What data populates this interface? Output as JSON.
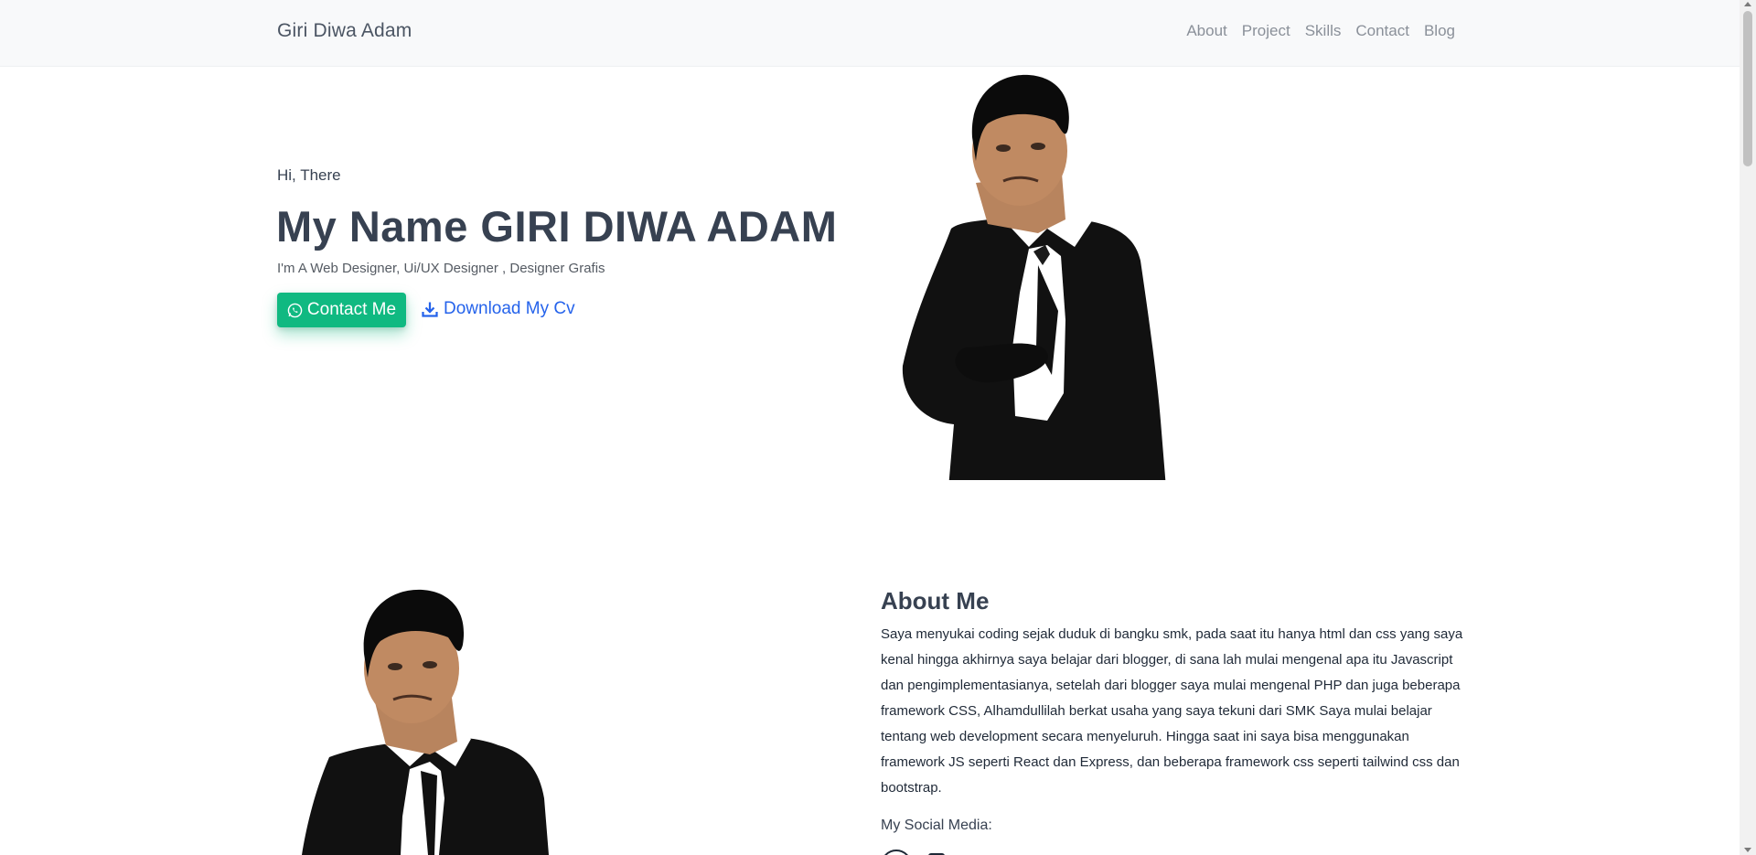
{
  "navbar": {
    "brand": "Giri Diwa Adam",
    "links": [
      "About",
      "Project",
      "Skills",
      "Contact",
      "Blog"
    ]
  },
  "hero": {
    "greeting": "Hi, There",
    "title": "My Name GIRI DIWA ADAM",
    "subtitle": "I'm A Web Designer, Ui/UX Designer , Designer Grafis",
    "contact_button": "Contact Me",
    "cv_link": "Download My Cv"
  },
  "about": {
    "title": "About Me",
    "text": "Saya menyukai coding sejak duduk di bangku smk, pada saat itu hanya html dan css yang saya kenal hingga akhirnya saya belajar dari blogger, di sana lah mulai mengenal apa itu Javascript dan pengimplementasianya, setelah dari blogger saya mulai mengenal PHP dan juga beberapa framework CSS, Alhamdullilah berkat usaha yang saya tekuni dari SMK Saya mulai belajar tentang web development secara menyeluruh. Hingga saat ini saya bisa menggunakan framework JS seperti React dan Express, dan beberapa framework css seperti tailwind css dan bootstrap.",
    "social_label": "My Social Media:"
  },
  "colors": {
    "accent_green": "#10b981",
    "link_blue": "#2563eb",
    "navbar_bg": "#f8f9fa"
  },
  "icons": {
    "contact": "whatsapp-icon",
    "cv": "download-icon"
  }
}
